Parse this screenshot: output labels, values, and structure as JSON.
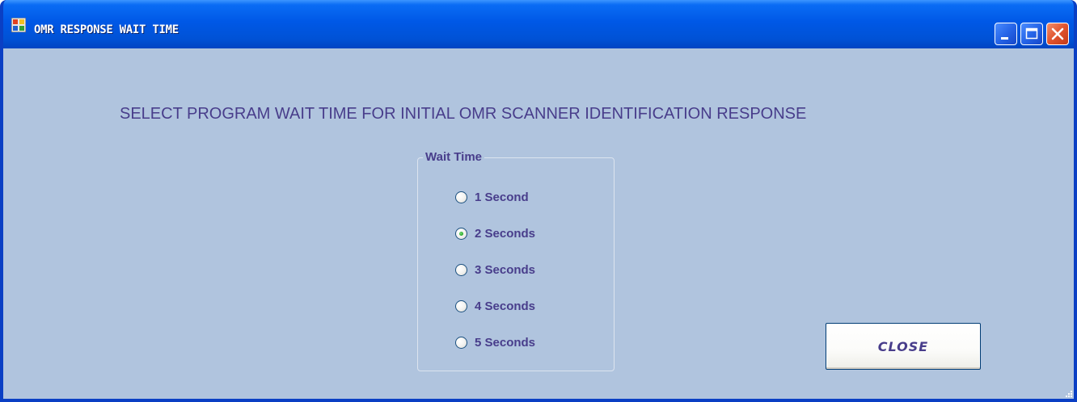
{
  "window": {
    "title": "OMR RESPONSE WAIT TIME",
    "controls": {
      "minimize_icon": "minimize-icon",
      "maximize_icon": "maximize-icon",
      "close_icon": "close-icon"
    }
  },
  "main": {
    "heading": "SELECT PROGRAM WAIT TIME FOR INITIAL OMR SCANNER IDENTIFICATION RESPONSE",
    "wait_time_group": {
      "legend": "Wait Time",
      "selected": "2 Seconds",
      "options": [
        {
          "label": "1 Second",
          "checked": false
        },
        {
          "label": "2 Seconds",
          "checked": true
        },
        {
          "label": "3 Seconds",
          "checked": false
        },
        {
          "label": "4 Seconds",
          "checked": false
        },
        {
          "label": "5 Seconds",
          "checked": false
        }
      ]
    },
    "close_button": {
      "label": "CLOSE"
    }
  },
  "colors": {
    "title_bar": "#0058e6",
    "client_background": "#b0c4de",
    "text": "#483d8b",
    "radio_selected_dot": "#21a121"
  }
}
